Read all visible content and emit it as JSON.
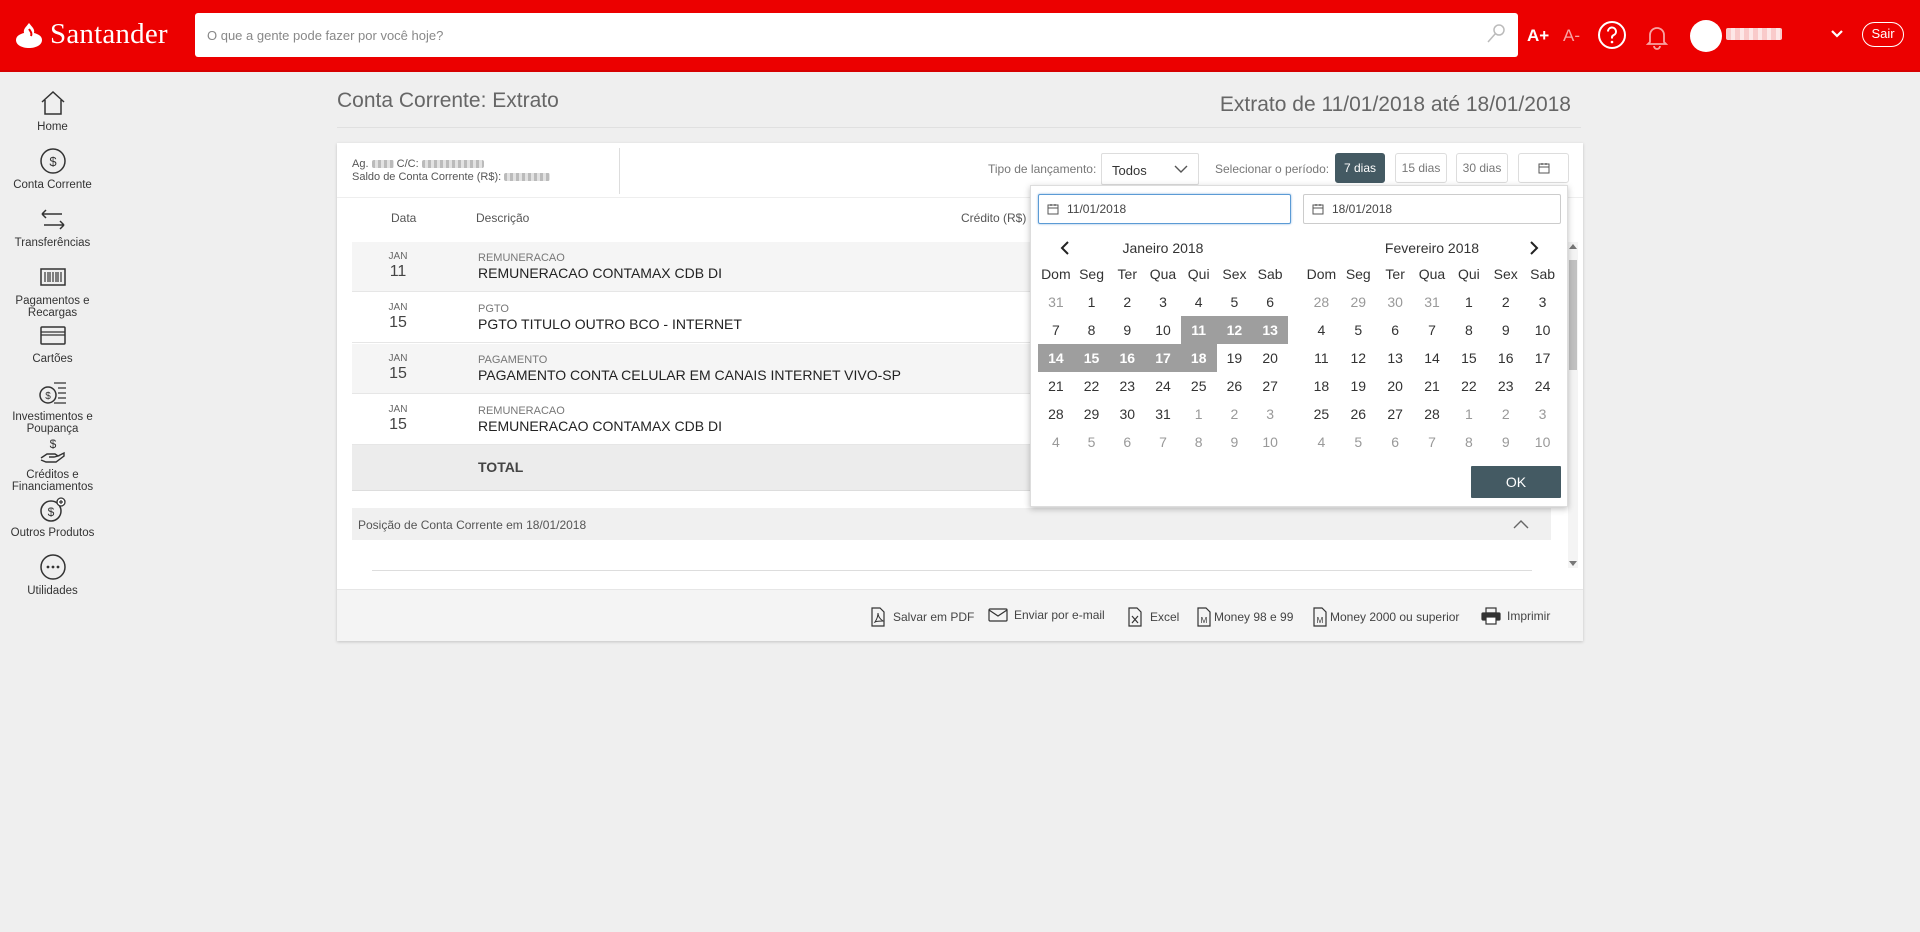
{
  "header": {
    "brand": "Santander",
    "search_placeholder": "O que a gente pode fazer por você hoje?",
    "font_increase": "A+",
    "font_decrease": "A-",
    "logout": "Sair"
  },
  "sidebar": {
    "items": [
      {
        "label": "Home",
        "icon": "home-icon"
      },
      {
        "label": "Conta Corrente",
        "icon": "dollar-circle-icon"
      },
      {
        "label": "Transferências",
        "icon": "transfer-arrows-icon"
      },
      {
        "label": "Pagamentos e Recargas",
        "icon": "barcode-icon"
      },
      {
        "label": "Cartões",
        "icon": "card-icon"
      },
      {
        "label": "Investimentos e Poupança",
        "icon": "investment-icon"
      },
      {
        "label": "Créditos e Financiamentos",
        "icon": "hand-money-icon"
      },
      {
        "label": "Outros Produtos",
        "icon": "dollar-plus-icon"
      },
      {
        "label": "Utilidades",
        "icon": "dots-icon"
      }
    ]
  },
  "page": {
    "title": "Conta Corrente: Extrato",
    "period": "Extrato de 11/01/2018 até 18/01/2018"
  },
  "account": {
    "agency_label": "Ag.",
    "account_label": "C/C:",
    "balance_label": "Saldo de Conta Corrente (R$):"
  },
  "filters": {
    "type_label": "Tipo de lançamento:",
    "type_value": "Todos",
    "period_label": "Selecionar o período:",
    "periods": [
      "7 dias",
      "15 dias",
      "30 dias"
    ],
    "active_period": "7 dias"
  },
  "table": {
    "headers": [
      "Data",
      "Descrição",
      "Crédito (R$)"
    ],
    "rows": [
      {
        "month": "JAN",
        "day": "11",
        "type": "REMUNERACAO",
        "description": "REMUNERACAO CONTAMAX CDB DI"
      },
      {
        "month": "JAN",
        "day": "15",
        "type": "PGTO",
        "description": "PGTO TITULO OUTRO BCO - INTERNET"
      },
      {
        "month": "JAN",
        "day": "15",
        "type": "PAGAMENTO",
        "description": "PAGAMENTO CONTA CELULAR EM CANAIS INTERNET VIVO-SP"
      },
      {
        "month": "JAN",
        "day": "15",
        "type": "REMUNERACAO",
        "description": "REMUNERACAO CONTAMAX CDB DI"
      }
    ],
    "total_label": "TOTAL"
  },
  "position": {
    "label": "Posição de Conta Corrente em 18/01/2018"
  },
  "exports": [
    {
      "label": "Salvar em PDF",
      "icon": "pdf-icon"
    },
    {
      "label": "Enviar por e-mail",
      "icon": "email-icon"
    },
    {
      "label": "Excel",
      "icon": "excel-icon"
    },
    {
      "label": "Money 98 e 99",
      "icon": "money-file-icon"
    },
    {
      "label": "Money 2000 ou superior",
      "icon": "money-file-icon"
    },
    {
      "label": "Imprimir",
      "icon": "printer-icon"
    }
  ],
  "calendar": {
    "start_date": "11/01/2018",
    "end_date": "18/01/2018",
    "weekdays": [
      "Dom",
      "Seg",
      "Ter",
      "Qua",
      "Qui",
      "Sex",
      "Sab"
    ],
    "ok_label": "OK",
    "months": [
      {
        "title": "Janeiro 2018",
        "days": [
          [
            "31",
            "1",
            "2",
            "3",
            "4",
            "5",
            "6"
          ],
          [
            "7",
            "8",
            "9",
            "10",
            "11",
            "12",
            "13"
          ],
          [
            "14",
            "15",
            "16",
            "17",
            "18",
            "19",
            "20"
          ],
          [
            "21",
            "22",
            "23",
            "24",
            "25",
            "26",
            "27"
          ],
          [
            "28",
            "29",
            "30",
            "31",
            "1",
            "2",
            "3"
          ],
          [
            "4",
            "5",
            "6",
            "7",
            "8",
            "9",
            "10"
          ]
        ]
      },
      {
        "title": "Fevereiro 2018",
        "days": [
          [
            "28",
            "29",
            "30",
            "31",
            "1",
            "2",
            "3"
          ],
          [
            "4",
            "5",
            "6",
            "7",
            "8",
            "9",
            "10"
          ],
          [
            "11",
            "12",
            "13",
            "14",
            "15",
            "16",
            "17"
          ],
          [
            "18",
            "19",
            "20",
            "21",
            "22",
            "23",
            "24"
          ],
          [
            "25",
            "26",
            "27",
            "28",
            "1",
            "2",
            "3"
          ],
          [
            "4",
            "5",
            "6",
            "7",
            "8",
            "9",
            "10"
          ]
        ]
      }
    ]
  },
  "colors": {
    "brand_red": "#ec0000",
    "dark_button": "#445a63",
    "selected_day": "#9e9e9e"
  }
}
